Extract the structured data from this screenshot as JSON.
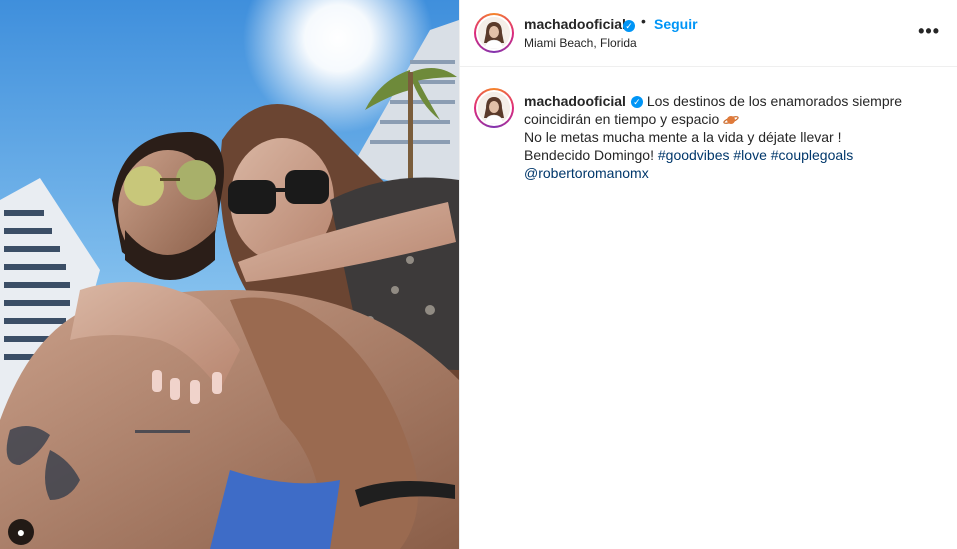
{
  "post": {
    "author": {
      "username": "machadooficial",
      "verified": true,
      "follow_label": "Seguir",
      "separator": "•",
      "location": "Miami Beach, Florida"
    },
    "more_label": "•••",
    "media_indicator": "●",
    "caption": {
      "username": "machadooficial",
      "line1": "Los destinos de los enamorados siempre coincidirán en tiempo y espacio",
      "emoji": "planet-emoji",
      "line2": "No le metas mucha mente a la vida y déjate llevar !",
      "line3": "Bendecido Domingo!",
      "hashtags": [
        "#goodvibes",
        "#love",
        "#couplegoals"
      ],
      "mention": "@robertoromanomx"
    },
    "colors": {
      "accent": "#0095f6",
      "link": "#00376b",
      "text": "#262626",
      "border": "#efefef"
    }
  }
}
